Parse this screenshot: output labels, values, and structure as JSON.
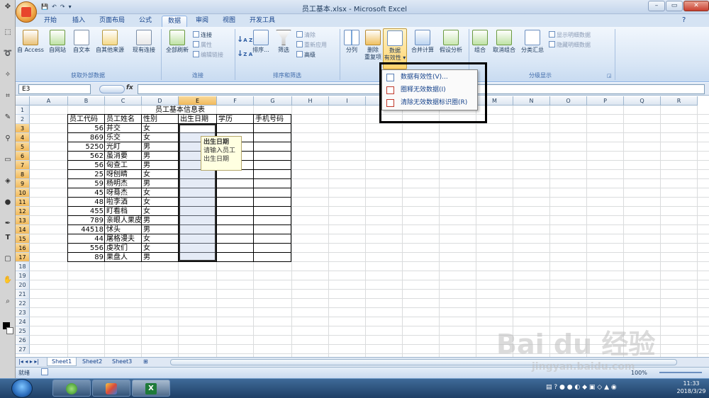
{
  "window": {
    "title": "员工基本.xlsx - Microsoft Excel"
  },
  "tabs": [
    {
      "label": "开始"
    },
    {
      "label": "插入"
    },
    {
      "label": "页面布局"
    },
    {
      "label": "公式"
    },
    {
      "label": "数据"
    },
    {
      "label": "审阅"
    },
    {
      "label": "视图"
    },
    {
      "label": "开发工具"
    }
  ],
  "ribbon": {
    "external": {
      "label": "获取外部数据",
      "access": "自 Access",
      "web": "自网站",
      "text": "自文本",
      "other": "自其他来源",
      "existing": "现有连接"
    },
    "connections": {
      "label": "连接",
      "refresh": "全部刷新",
      "conn": "连接",
      "props": "属性",
      "edit": "编辑链接"
    },
    "sort": {
      "label": "排序和筛选",
      "sort": "排序...",
      "filter": "筛选",
      "clear": "清除",
      "reapply": "重新应用",
      "advanced": "高级"
    },
    "tools": {
      "split": "分列",
      "remove_a": "删除",
      "remove_b": "重复项",
      "valid_a": "数据",
      "valid_b": "有效性",
      "consolidate": "合并计算",
      "whatif": "假设分析"
    },
    "outline": {
      "label": "分级显示",
      "group": "组合",
      "ungroup": "取消组合",
      "subtotal": "分类汇总",
      "show": "显示明细数据",
      "hide": "隐藏明细数据"
    }
  },
  "namebox": "E3",
  "fx": "fx",
  "columns": [
    "A",
    "B",
    "C",
    "D",
    "E",
    "F",
    "G",
    "H",
    "I",
    "J",
    "K",
    "L",
    "M",
    "N",
    "O",
    "P",
    "Q",
    "R"
  ],
  "rows": [
    "1",
    "2",
    "3",
    "4",
    "5",
    "6",
    "7",
    "8",
    "9",
    "10",
    "11",
    "12",
    "13",
    "14",
    "15",
    "16",
    "17",
    "18",
    "19",
    "20",
    "21",
    "22",
    "23",
    "24",
    "25",
    "26",
    "27"
  ],
  "sheet_title": "员工基本信息表",
  "headers": [
    "员工代码",
    "员工姓名",
    "性别",
    "出生日期",
    "学历",
    "手机号码"
  ],
  "employees": [
    {
      "code": "56",
      "name": "并交",
      "sex": "女"
    },
    {
      "code": "869",
      "name": "乐交",
      "sex": "女"
    },
    {
      "code": "5250",
      "name": "光盯",
      "sex": "男"
    },
    {
      "code": "562",
      "name": "虽消要",
      "sex": "男"
    },
    {
      "code": "56",
      "name": "匈查工",
      "sex": "男"
    },
    {
      "code": "25",
      "name": "呀刨睛",
      "sex": "女"
    },
    {
      "code": "59",
      "name": "杨明杰",
      "sex": "男"
    },
    {
      "code": "45",
      "name": "呀蓦杰",
      "sex": "女"
    },
    {
      "code": "48",
      "name": "啦李酒",
      "sex": "女"
    },
    {
      "code": "455",
      "name": "盯看档",
      "sex": "女"
    },
    {
      "code": "789",
      "name": "亲眼人果皮",
      "sex": "男"
    },
    {
      "code": "44518",
      "name": "怵头",
      "sex": "男"
    },
    {
      "code": "44",
      "name": "屠格漫夫",
      "sex": "女"
    },
    {
      "code": "556",
      "name": "虔攻们",
      "sex": "女"
    },
    {
      "code": "89",
      "name": "果盘人",
      "sex": "男"
    }
  ],
  "tooltip": {
    "title": "出生日期",
    "line1": "请输入员工",
    "line2": "出生日期"
  },
  "dropdown": [
    {
      "label": "数据有效性(V)..."
    },
    {
      "label": "圈释无效数据(I)"
    },
    {
      "label": "清除无效数据标识圈(R)"
    }
  ],
  "sheets": [
    "Sheet1",
    "Sheet2",
    "Sheet3"
  ],
  "status": {
    "ready": "就绪",
    "zoom": "100%"
  },
  "clock": {
    "time": "11:33",
    "date": "2018/3/29"
  },
  "watermark": "Bai du 经验",
  "watermark_url": "jingyan.baidu.com"
}
